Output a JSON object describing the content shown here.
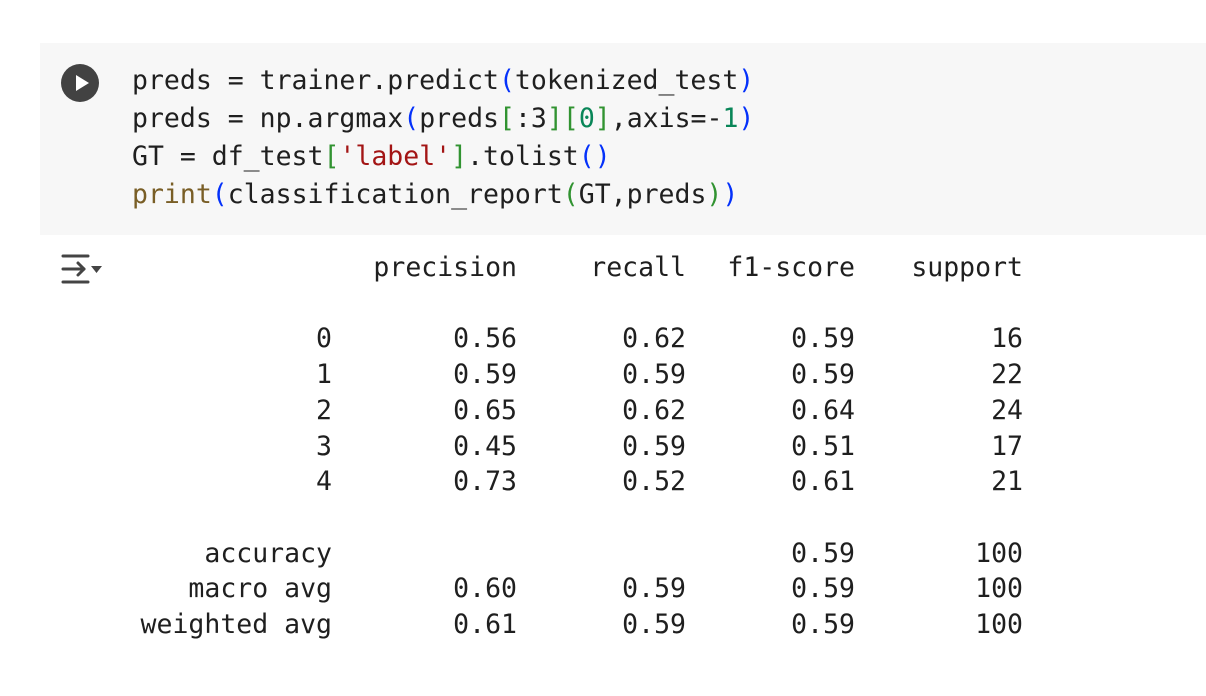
{
  "cell": {
    "code_lines": [
      [
        {
          "t": "preds = trainer.predict",
          "c": ""
        },
        {
          "t": "(",
          "c": "tok-paren"
        },
        {
          "t": "tokenized_test",
          "c": ""
        },
        {
          "t": ")",
          "c": "tok-paren"
        }
      ],
      [
        {
          "t": "preds = np.argmax",
          "c": ""
        },
        {
          "t": "(",
          "c": "tok-paren"
        },
        {
          "t": "preds",
          "c": ""
        },
        {
          "t": "[",
          "c": "tok-bracket"
        },
        {
          "t": ":3",
          "c": ""
        },
        {
          "t": "]",
          "c": "tok-bracket"
        },
        {
          "t": "[",
          "c": "tok-bracket"
        },
        {
          "t": "0",
          "c": "tok-num"
        },
        {
          "t": "]",
          "c": "tok-bracket"
        },
        {
          "t": ",axis=-",
          "c": ""
        },
        {
          "t": "1",
          "c": "tok-num"
        },
        {
          "t": ")",
          "c": "tok-paren"
        }
      ],
      [
        {
          "t": "GT = df_test",
          "c": ""
        },
        {
          "t": "[",
          "c": "tok-bracket"
        },
        {
          "t": "'label'",
          "c": "tok-str"
        },
        {
          "t": "]",
          "c": "tok-bracket"
        },
        {
          "t": ".tolist",
          "c": ""
        },
        {
          "t": "(",
          "c": "tok-paren"
        },
        {
          "t": ")",
          "c": "tok-paren"
        }
      ],
      [
        {
          "t": "print",
          "c": "tok-builtin"
        },
        {
          "t": "(",
          "c": "tok-paren"
        },
        {
          "t": "classification_report",
          "c": ""
        },
        {
          "t": "(",
          "c": "tok-bracket"
        },
        {
          "t": "GT,preds",
          "c": ""
        },
        {
          "t": ")",
          "c": "tok-bracket"
        },
        {
          "t": ")",
          "c": "tok-paren"
        }
      ]
    ],
    "run_icon": "play-icon",
    "output_icon": "output-toggle-icon"
  },
  "report": {
    "header": [
      "precision",
      "recall",
      "f1-score",
      "support"
    ],
    "rows": [
      {
        "label": "0",
        "precision": "0.56",
        "recall": "0.62",
        "f1": "0.59",
        "support": "16"
      },
      {
        "label": "1",
        "precision": "0.59",
        "recall": "0.59",
        "f1": "0.59",
        "support": "22"
      },
      {
        "label": "2",
        "precision": "0.65",
        "recall": "0.62",
        "f1": "0.64",
        "support": "24"
      },
      {
        "label": "3",
        "precision": "0.45",
        "recall": "0.59",
        "f1": "0.51",
        "support": "17"
      },
      {
        "label": "4",
        "precision": "0.73",
        "recall": "0.52",
        "f1": "0.61",
        "support": "21"
      }
    ],
    "summary": [
      {
        "label": "accuracy",
        "precision": "",
        "recall": "",
        "f1": "0.59",
        "support": "100"
      },
      {
        "label": "macro avg",
        "precision": "0.60",
        "recall": "0.59",
        "f1": "0.59",
        "support": "100"
      },
      {
        "label": "weighted avg",
        "precision": "0.61",
        "recall": "0.59",
        "f1": "0.59",
        "support": "100"
      }
    ]
  },
  "colors": {
    "cell_background": "#f7f7f7",
    "run_button": "#424242",
    "paren": "#0431fa",
    "bracket": "#319331",
    "string": "#a31515",
    "number": "#098658",
    "builtin": "#795e26"
  }
}
